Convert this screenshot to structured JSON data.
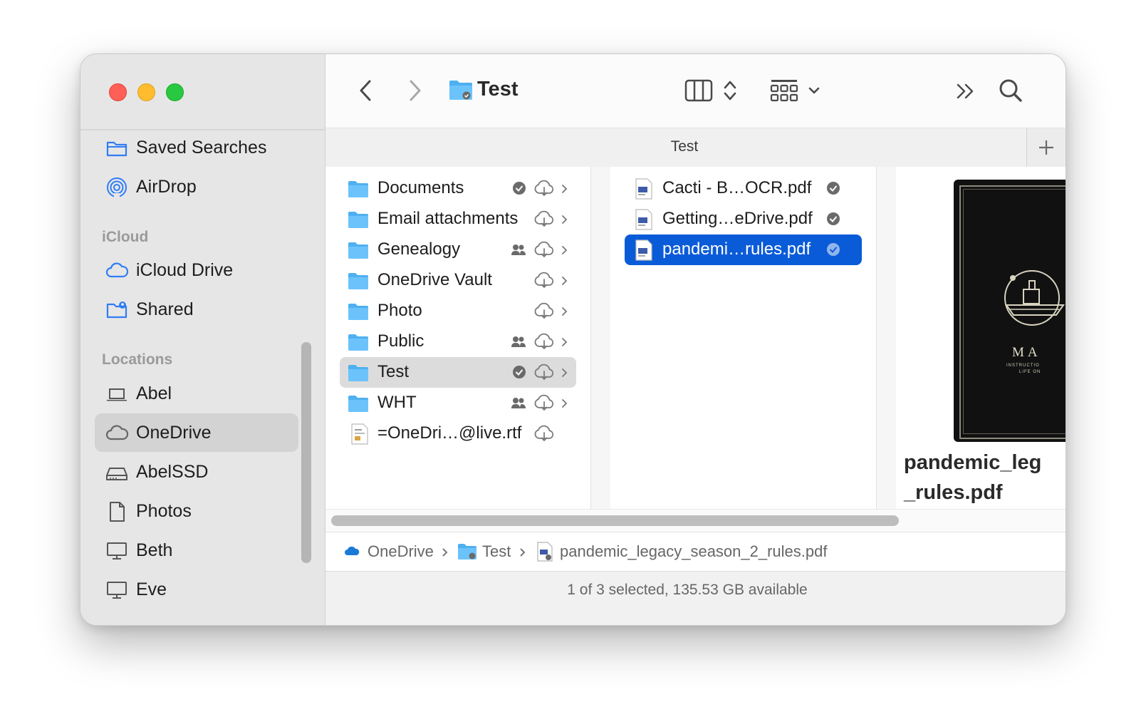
{
  "toolbar": {
    "title": "Test",
    "tab_title": "Test"
  },
  "sidebar": {
    "favorites": [
      {
        "label": "Saved Searches",
        "icon": "folder-outline-icon"
      },
      {
        "label": "AirDrop",
        "icon": "airdrop-icon"
      }
    ],
    "icloud_header": "iCloud",
    "icloud": [
      {
        "label": "iCloud Drive",
        "icon": "cloud-icon"
      },
      {
        "label": "Shared",
        "icon": "shared-folder-icon"
      }
    ],
    "locations_header": "Locations",
    "locations": [
      {
        "label": "Abel",
        "icon": "laptop-icon"
      },
      {
        "label": "OneDrive",
        "icon": "cloud-icon",
        "selected": true
      },
      {
        "label": "AbelSSD",
        "icon": "external-drive-icon"
      },
      {
        "label": "Photos",
        "icon": "document-icon"
      },
      {
        "label": "Beth",
        "icon": "monitor-icon"
      },
      {
        "label": "Eve",
        "icon": "monitor-icon"
      }
    ]
  },
  "column1": {
    "items": [
      {
        "label": "Documents",
        "badges": [
          "check",
          "cloud"
        ],
        "chevron": true
      },
      {
        "label": "Email attachments",
        "badges": [
          "cloud"
        ],
        "chevron": true
      },
      {
        "label": "Genealogy",
        "badges": [
          "shared",
          "cloud"
        ],
        "chevron": true
      },
      {
        "label": "OneDrive Vault",
        "badges": [
          "cloud"
        ],
        "chevron": true
      },
      {
        "label": "Photo",
        "badges": [
          "cloud"
        ],
        "chevron": true
      },
      {
        "label": "Public",
        "badges": [
          "shared",
          "cloud"
        ],
        "chevron": true
      },
      {
        "label": "Test",
        "badges": [
          "check",
          "cloud"
        ],
        "chevron": true,
        "highlighted": true
      },
      {
        "label": "WHT",
        "badges": [
          "shared",
          "cloud"
        ],
        "chevron": true
      },
      {
        "label": "=OneDri…@live.rtf",
        "badges": [
          "cloud"
        ],
        "chevron": false,
        "file": true
      }
    ]
  },
  "column2": {
    "items": [
      {
        "label": "Cacti - B…OCR.pdf"
      },
      {
        "label": "Getting…eDrive.pdf"
      },
      {
        "label": "pandemi…rules.pdf",
        "selected": true
      }
    ]
  },
  "preview": {
    "cover_letters": "MA",
    "cover_small_1": "INSTRUCTIO",
    "cover_small_2": "LIFE ON",
    "name": "pandemic_leg\n_rules.pdf"
  },
  "breadcrumbs": [
    {
      "label": "OneDrive"
    },
    {
      "label": "Test"
    },
    {
      "label": "pandemic_legacy_season_2_rules.pdf"
    }
  ],
  "status": "1 of 3 selected, 135.53 GB available",
  "colors": {
    "selection": "#0a5bd8",
    "folder": "#4fb0f1",
    "sidebar_icon": "#2f7df6"
  }
}
